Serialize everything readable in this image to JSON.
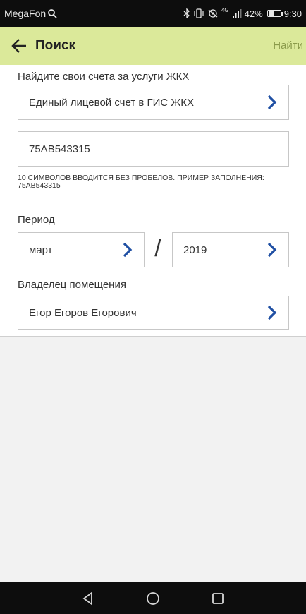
{
  "status": {
    "carrier": "MegaFon",
    "signal_label": "4G",
    "battery": "42%",
    "battery_level": 0.42,
    "time": "9:30"
  },
  "header": {
    "title": "Поиск",
    "action": "Найти"
  },
  "form": {
    "section_title": "Найдите свои счета за услуги ЖКХ",
    "account_type": "Единый лицевой счет в ГИС ЖКХ",
    "account_number": "75AB543315",
    "hint": "10 символов вводится без пробелов. Пример заполнения: 75AB543315",
    "period_label": "Период",
    "month": "март",
    "period_separator": "/",
    "year": "2019",
    "owner_label": "Владелец помещения",
    "owner": "Егор Егоров Егорович"
  },
  "colors": {
    "header_bg": "#dbe99a",
    "accent": "#1f4fa3",
    "action_text": "#8a9a4a"
  },
  "icons": {
    "back": "arrow-left",
    "chevron": "chevron-right",
    "nav_back": "triangle-left",
    "nav_home": "circle",
    "nav_recent": "square"
  }
}
